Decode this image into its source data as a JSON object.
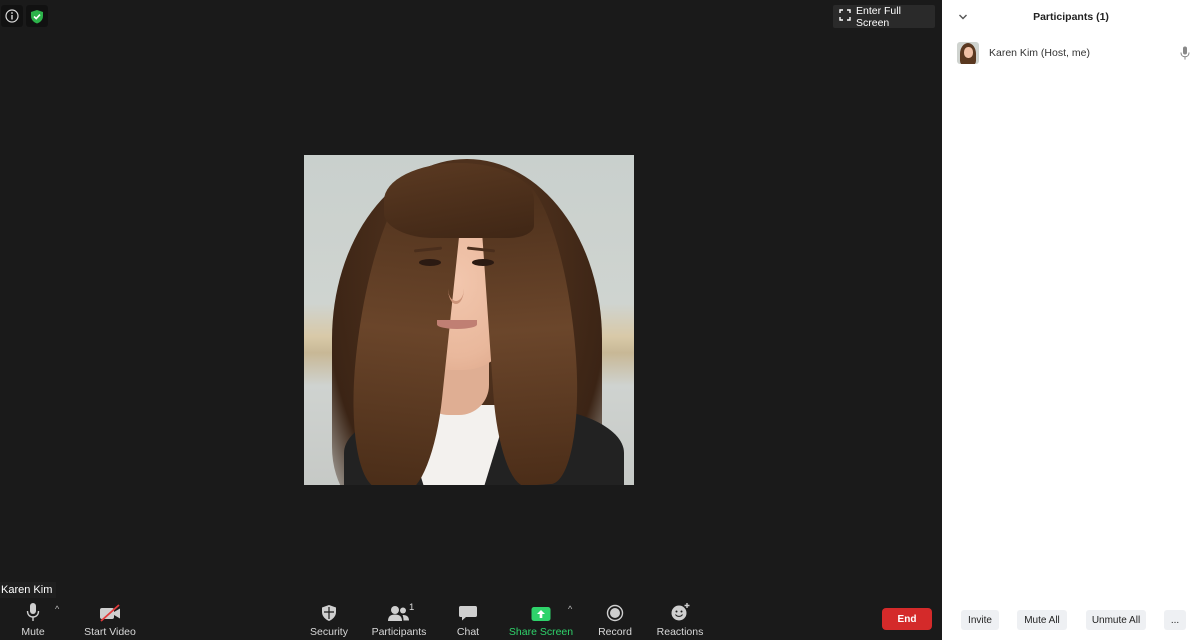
{
  "meeting": {
    "fullscreen_label": "Enter Full Screen",
    "name_label": "Karen Kim"
  },
  "toolbar": {
    "mute_label": "Mute",
    "video_label": "Start Video",
    "security_label": "Security",
    "participants_label": "Participants",
    "participants_count": "1",
    "chat_label": "Chat",
    "share_label": "Share Screen",
    "record_label": "Record",
    "reactions_label": "Reactions",
    "end_label": "End"
  },
  "panel": {
    "title": "Participants (1)",
    "participants": [
      {
        "name": "Karen Kim (Host, me)"
      }
    ],
    "footer": {
      "invite": "Invite",
      "mute_all": "Mute All",
      "unmute_all": "Unmute All",
      "more": "..."
    }
  },
  "colors": {
    "background": "#1a1a1a",
    "share_green": "#2fd36b",
    "end_red": "#d42a2a",
    "shield_green": "#2cb34a"
  },
  "icons": [
    "info-icon",
    "shield-icon",
    "fullscreen-icon",
    "mic-icon",
    "video-off-icon",
    "security-shield-icon",
    "participants-icon",
    "chat-icon",
    "share-screen-icon",
    "record-icon",
    "reactions-icon",
    "chevron-down-icon"
  ]
}
